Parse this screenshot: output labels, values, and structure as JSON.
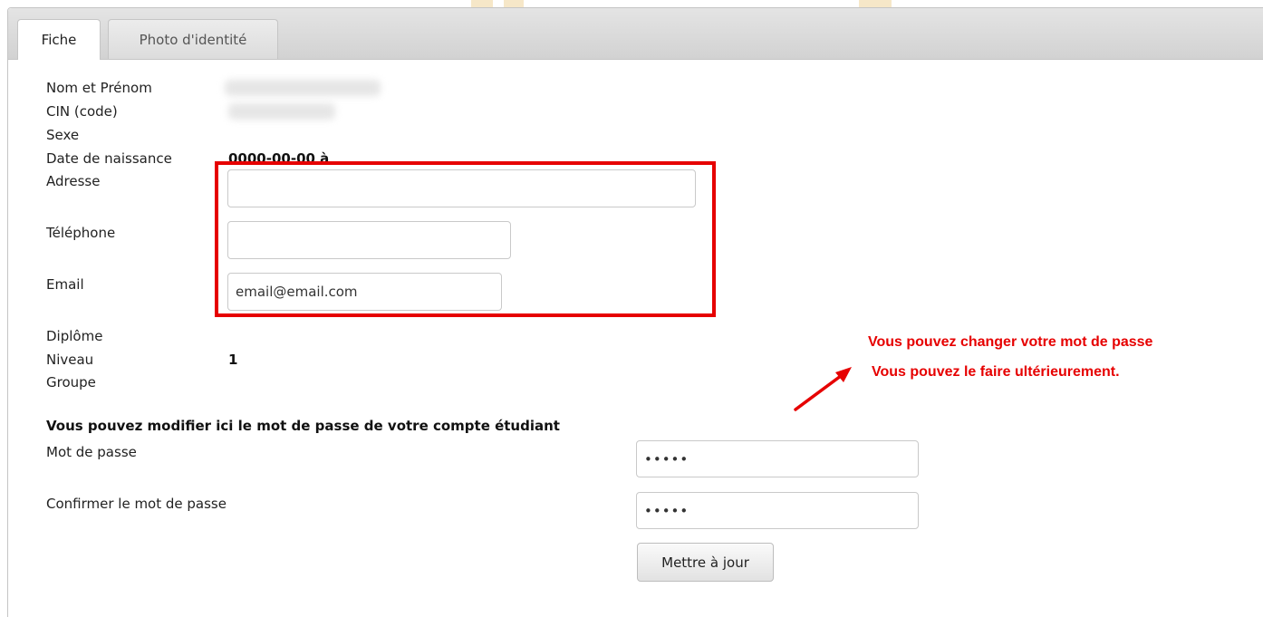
{
  "tabs": {
    "active": "Fiche",
    "inactive": "Photo d'identité"
  },
  "fields": {
    "nom_label": "Nom et Prénom",
    "cin_label": "CIN (code)",
    "sexe_label": "Sexe",
    "naissance_label": "Date de naissance",
    "naissance_value": "0000-00-00 à",
    "adresse_label": "Adresse",
    "adresse_value": "",
    "telephone_label": "Téléphone",
    "telephone_value": "",
    "email_label": "Email",
    "email_value": "email@email.com",
    "diplome_label": "Diplôme",
    "niveau_label": "Niveau",
    "niveau_value": "1",
    "groupe_label": "Groupe"
  },
  "password": {
    "section_title": "Vous pouvez modifier ici le mot de passe de votre compte étudiant",
    "mdp_label": "Mot de passe",
    "mdp_value": "•••••",
    "confirm_label": "Confirmer le mot de passe",
    "confirm_value": "•••••",
    "submit_label": "Mettre à jour"
  },
  "annotation": {
    "line1": "Vous pouvez changer votre mot de passe",
    "line2": "Vous pouvez le faire ultérieurement.",
    "color": "#e60000"
  }
}
